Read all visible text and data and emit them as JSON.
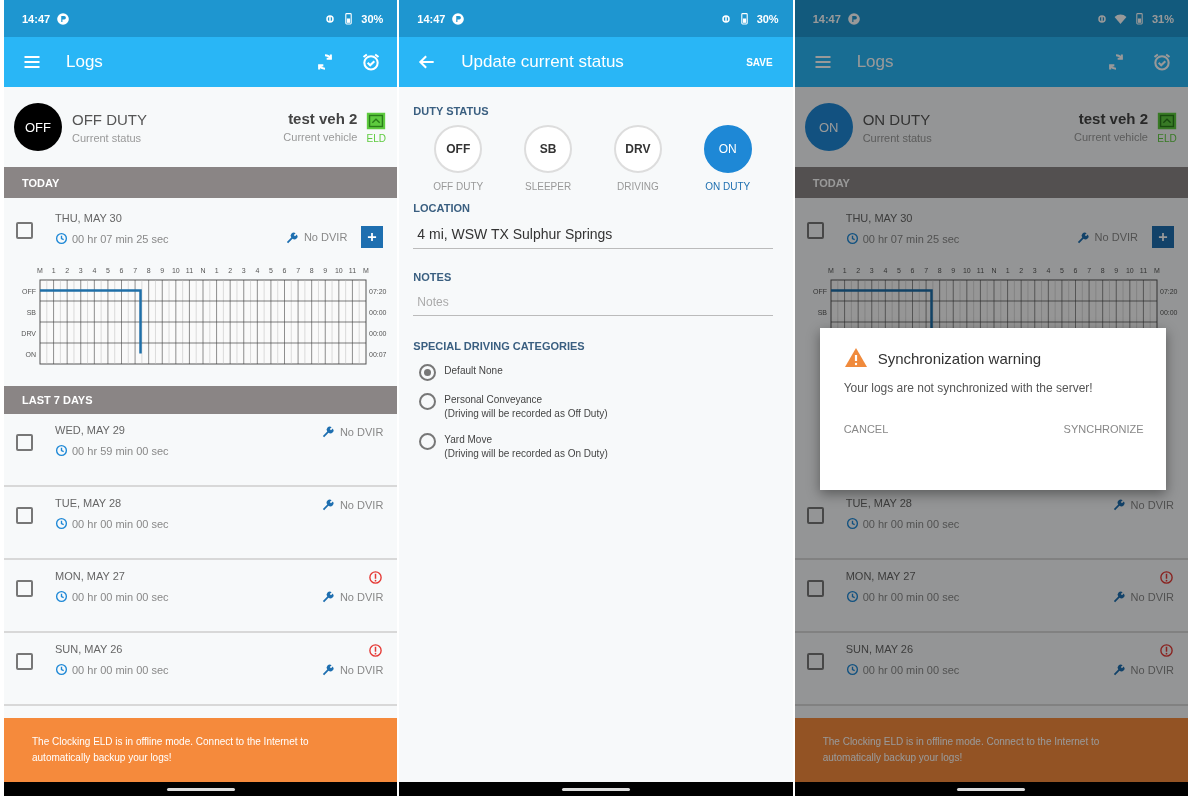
{
  "screens": [
    {
      "kind": "logs",
      "status_bar": {
        "time": "14:47",
        "battery": "30%",
        "wifi": false
      },
      "app_bar": {
        "title": "Logs"
      },
      "current_status": {
        "kind": "off",
        "code": "OFF",
        "label": "OFF DUTY",
        "caption": "Current status"
      },
      "vehicle": {
        "name": "test veh 2",
        "caption": "Current vehicle",
        "badge": "ELD"
      },
      "sections": [
        {
          "header": "TODAY",
          "days": [
            {
              "date": "THU, MAY 30",
              "duration": "00 hr 07 min 25 sec",
              "dvir": "No DVIR",
              "checked": false,
              "warning": false,
              "add_button": true,
              "graph": {
                "hour_labels": [
                  "M",
                  "1",
                  "2",
                  "3",
                  "4",
                  "5",
                  "6",
                  "7",
                  "8",
                  "9",
                  "10",
                  "11",
                  "N",
                  "1",
                  "2",
                  "3",
                  "4",
                  "5",
                  "6",
                  "7",
                  "8",
                  "9",
                  "10",
                  "11",
                  "M"
                ],
                "status_labels": [
                  "OFF",
                  "SB",
                  "DRV",
                  "ON"
                ],
                "totals": [
                  "07:20",
                  "00:00",
                  "00:00",
                  "00:07"
                ]
              }
            }
          ]
        },
        {
          "header": "LAST 7 DAYS",
          "days": [
            {
              "date": "WED, MAY 29",
              "duration": "00 hr 59 min 00 sec",
              "dvir": "No DVIR",
              "checked": false,
              "warning": false,
              "add_button": false
            },
            {
              "date": "TUE, MAY 28",
              "duration": "00 hr 00 min 00 sec",
              "dvir": "No DVIR",
              "checked": false,
              "warning": false,
              "add_button": false
            },
            {
              "date": "MON, MAY 27",
              "duration": "00 hr 00 min 00 sec",
              "dvir": "No DVIR",
              "checked": false,
              "warning": true,
              "add_button": false
            },
            {
              "date": "SUN, MAY 26",
              "duration": "00 hr 00 min 00 sec",
              "dvir": "No DVIR",
              "checked": false,
              "warning": true,
              "add_button": false
            }
          ]
        }
      ],
      "banner": "The Clocking ELD is in offline mode. Connect to the Internet to automatically backup your logs!"
    },
    {
      "kind": "status_form",
      "status_bar": {
        "time": "14:47",
        "battery": "30%",
        "wifi": false
      },
      "app_bar": {
        "title": "Update current status",
        "action": "SAVE"
      },
      "duty_status": {
        "label": "DUTY STATUS",
        "options": [
          {
            "code": "OFF",
            "label": "OFF DUTY",
            "selected": false
          },
          {
            "code": "SB",
            "label": "SLEEPER",
            "selected": false
          },
          {
            "code": "DRV",
            "label": "DRIVING",
            "selected": false
          },
          {
            "code": "ON",
            "label": "ON DUTY",
            "selected": true
          }
        ]
      },
      "location": {
        "label": "LOCATION",
        "value": "4 mi, WSW TX Sulphur Springs"
      },
      "notes": {
        "label": "NOTES",
        "placeholder": "Notes"
      },
      "categories": {
        "label": "SPECIAL DRIVING CATEGORIES",
        "options": [
          {
            "label": "Default None",
            "selected": true
          },
          {
            "label": "Personal Conveyance",
            "note": "(Driving will be recorded as Off Duty)",
            "selected": false
          },
          {
            "label": "Yard Move",
            "note": "(Driving will be recorded as On Duty)",
            "selected": false
          }
        ]
      }
    },
    {
      "kind": "logs",
      "status_bar": {
        "time": "14:47",
        "battery": "31%",
        "wifi": true
      },
      "app_bar": {
        "title": "Logs"
      },
      "current_status": {
        "kind": "on",
        "code": "ON",
        "label": "ON DUTY",
        "caption": "Current status"
      },
      "vehicle": {
        "name": "test veh 2",
        "caption": "Current vehicle",
        "badge": "ELD"
      },
      "sections": [
        {
          "header": "TODAY",
          "days": [
            {
              "date": "THU, MAY 30",
              "duration": "00 hr 07 min 25 sec",
              "dvir": "No DVIR",
              "checked": false,
              "warning": false,
              "add_button": true,
              "graph": {
                "hour_labels": [
                  "M",
                  "1",
                  "2",
                  "3",
                  "4",
                  "5",
                  "6",
                  "7",
                  "8",
                  "9",
                  "10",
                  "11",
                  "N",
                  "1",
                  "2",
                  "3",
                  "4",
                  "5",
                  "6",
                  "7",
                  "8",
                  "9",
                  "10",
                  "11",
                  "M"
                ],
                "status_labels": [
                  "OFF",
                  "SB"
                ],
                "totals": [
                  "07:20",
                  "00:00"
                ]
              }
            }
          ]
        },
        {
          "days": [
            {
              "date": "TUE, MAY 28",
              "duration": "00 hr 00 min 00 sec",
              "dvir": "No DVIR",
              "checked": false,
              "warning": false,
              "add_button": false
            },
            {
              "date": "MON, MAY 27",
              "duration": "00 hr 00 min 00 sec",
              "dvir": "No DVIR",
              "checked": false,
              "warning": true,
              "add_button": false
            },
            {
              "date": "SUN, MAY 26",
              "duration": "00 hr 00 min 00 sec",
              "dvir": "No DVIR",
              "checked": false,
              "warning": true,
              "add_button": false
            }
          ]
        }
      ],
      "banner": "The Clocking ELD is in offline mode. Connect to the Internet to automatically backup your logs!",
      "dialog": {
        "title": "Synchronization warning",
        "message": "Your logs are not synchronized with the server!",
        "buttons": [
          "CANCEL",
          "SYNCHRONIZE"
        ]
      }
    }
  ]
}
